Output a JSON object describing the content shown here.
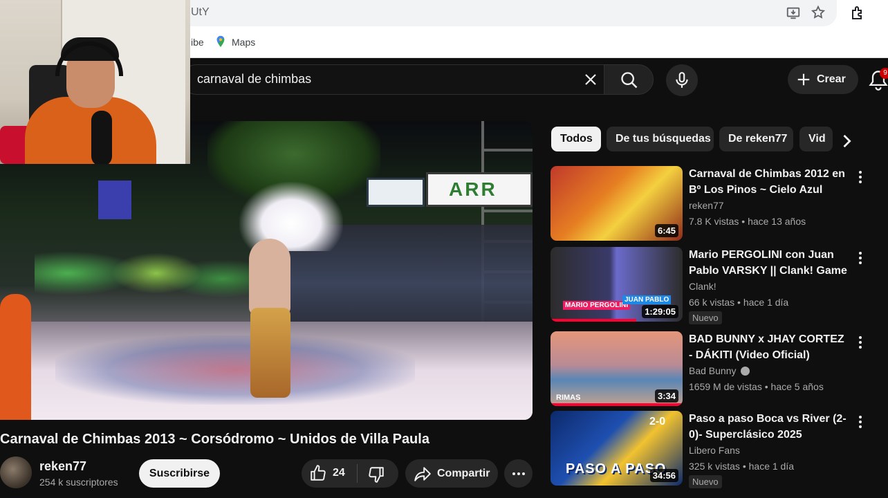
{
  "browser": {
    "url_fragment": "UtY",
    "bookmarks": {
      "partial": "ibe",
      "maps": "Maps"
    }
  },
  "header": {
    "search_query": "carnaval de chimbas",
    "create_label": "Crear",
    "notification_count": "9"
  },
  "video": {
    "title": "Carnaval de Chimbas 2013 ~ Corsódromo ~ Unidos de Villa Paula",
    "channel": "reken77",
    "subscribers": "254 k suscriptores",
    "subscribe_label": "Suscribirse",
    "likes": "24",
    "share_label": "Compartir",
    "scene_sign": "ARR"
  },
  "chips": [
    {
      "label": "Todos",
      "active": true
    },
    {
      "label": "De tus búsquedas",
      "active": false
    },
    {
      "label": "De reken77",
      "active": false
    },
    {
      "label": "Vid",
      "active": false
    }
  ],
  "suggestions": [
    {
      "title": "Carnaval de Chimbas 2012 en Bº Los Pinos ~ Cielo Azul",
      "channel": "reken77",
      "views": "7.8 K vistas",
      "age": "hace 13 años",
      "duration": "6:45",
      "badge": "",
      "verified": false
    },
    {
      "title": "Mario PERGOLINI con Juan Pablo VARSKY || Clank! Game ...",
      "channel": "Clank!",
      "views": "66 k vistas",
      "age": "hace 1 día",
      "duration": "1:29:05",
      "badge": "Nuevo",
      "verified": false,
      "watched_progress": 0.65,
      "thumb_text": {
        "left": "MARIO PERGOLINI",
        "right": "JUAN PABLO"
      }
    },
    {
      "title": "BAD BUNNY x JHAY CORTEZ - DÁKITI (Video Oficial)",
      "channel": "Bad Bunny",
      "views": "1659 M de vistas",
      "age": "hace 5 años",
      "duration": "3:34",
      "badge": "",
      "verified": true,
      "watched_progress": 1.0,
      "thumb_text": "RIMAS"
    },
    {
      "title": "Paso a paso Boca vs River  (2-0)- Superclásico 2025",
      "channel": "Libero Fans",
      "views": "325 k vistas",
      "age": "hace 1 día",
      "duration": "34:56",
      "badge": "Nuevo",
      "verified": false,
      "thumb_text": {
        "big": "PASO A PASO",
        "score": "2-0"
      }
    }
  ],
  "colors": {
    "background": "#0f0f0f",
    "chip_active": "#f1f1f1",
    "progress": "#ff0033",
    "notification": "#cc0000"
  }
}
